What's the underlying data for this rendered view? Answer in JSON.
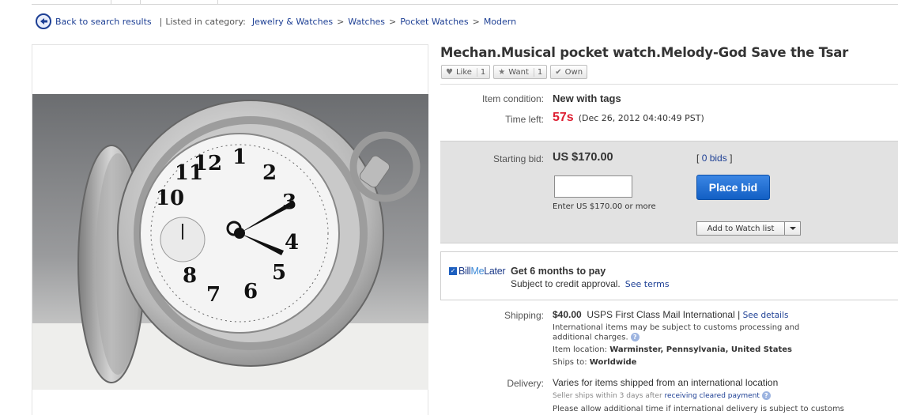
{
  "breadcrumb": {
    "back_label": "Back to search results",
    "listed_label": "Listed in category:",
    "items": [
      "Jewelry & Watches",
      "Watches",
      "Pocket Watches",
      "Modern"
    ],
    "separator": ">"
  },
  "item": {
    "title": "Mechan.Musical pocket watch.Melody-God Save the Tsar",
    "image_alt": "pocket watch photo"
  },
  "social": {
    "like_label": "Like",
    "like_count": "1",
    "want_label": "Want",
    "want_count": "1",
    "own_label": "Own"
  },
  "details": {
    "condition_label": "Item condition:",
    "condition_value": "New with tags",
    "time_label": "Time left:",
    "time_value": "57s",
    "time_end": "(Dec 26, 2012  04:40:49 PST)"
  },
  "bid": {
    "starting_label": "Starting bid:",
    "starting_value": "US $170.00",
    "bids_prefix": "[",
    "bids_link": "0 bids",
    "bids_suffix": "]",
    "input_placeholder": "",
    "enter_hint": "Enter US $170.00 or more",
    "place_bid_label": "Place bid",
    "watch_label": "Add to Watch list"
  },
  "billmelater": {
    "logo_check": "✓",
    "logo_bill": "Bill",
    "logo_me": "Me",
    "logo_later": "Later",
    "headline": "Get 6 months to pay",
    "subtext": "Subject to credit approval.",
    "terms_link": "See terms"
  },
  "shipping": {
    "label": "Shipping:",
    "price": "$40.00",
    "method": "USPS First Class Mail International |",
    "details_link": "See details",
    "intl_note_1": "International items may be subject to customs processing and",
    "intl_note_2": "additional charges.",
    "location_label": "Item location:",
    "location_value": "Warminster, Pennsylvania, United States",
    "ships_label": "Ships to:",
    "ships_value": "Worldwide"
  },
  "delivery": {
    "label": "Delivery:",
    "value": "Varies for items shipped from an international location",
    "seller_note": "Seller ships within 3 days after",
    "seller_link": "receiving cleared payment",
    "allow_note": "Please allow additional time if international delivery is subject to customs"
  },
  "colors": {
    "link": "#1d3f94",
    "time_red": "#dd1e31",
    "bid_box": "#e2e2e2",
    "place_bid": "#1f6fd6"
  }
}
